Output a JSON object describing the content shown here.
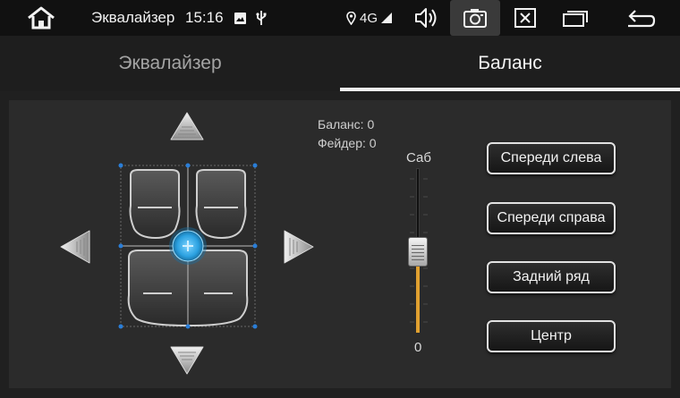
{
  "statusbar": {
    "title": "Эквалайзер",
    "time": "15:16",
    "network": "4G"
  },
  "tabs": [
    {
      "label": "Эквалайзер",
      "active": false
    },
    {
      "label": "Баланс",
      "active": true
    }
  ],
  "readout": {
    "balance": "Баланс: 0",
    "fader": "Фейдер: 0"
  },
  "subwoofer": {
    "label": "Саб",
    "value": "0",
    "level": 0
  },
  "presets": [
    {
      "label": "Спереди слева"
    },
    {
      "label": "Спереди справа"
    },
    {
      "label": "Задний ряд"
    },
    {
      "label": "Центр"
    }
  ],
  "colors": {
    "accent": "#2aa0e0",
    "slider_fill": "#e0a030",
    "background": "#202020",
    "panel": "#2b2b2b"
  },
  "icons": [
    "home-icon",
    "image-icon",
    "usb-icon",
    "location-icon",
    "signal-icon",
    "volume-icon",
    "camera-icon",
    "close-box-icon",
    "windows-icon",
    "back-icon"
  ]
}
